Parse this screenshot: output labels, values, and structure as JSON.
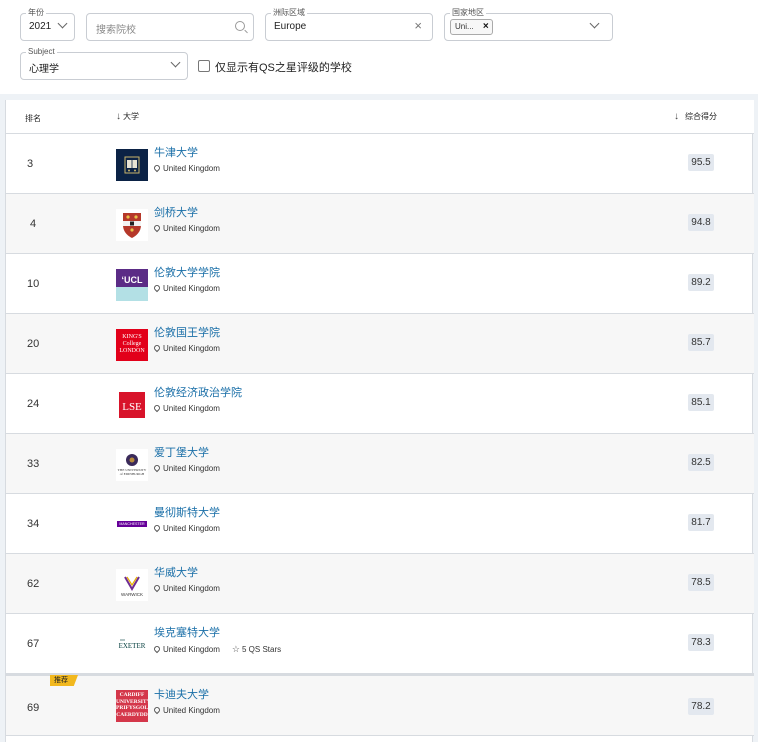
{
  "filters": {
    "year": {
      "legend": "年份",
      "value": "2021"
    },
    "search": {
      "placeholder": "搜索院校"
    },
    "region": {
      "legend": "洲际区域",
      "value": "Europe"
    },
    "country": {
      "legend": "国家地区",
      "chip": "Uni..."
    },
    "subject": {
      "legend": "Subject",
      "value": "心理学"
    },
    "qs_only_label": "仅显示有QS之星评级的学校"
  },
  "table": {
    "headers": {
      "rank": "排名",
      "university": "大学",
      "score": "综合得分"
    },
    "recommend_badge": "推荐",
    "rows": [
      {
        "rank": "3",
        "name": "牛津大学",
        "location": "United Kingdom",
        "score": "95.5"
      },
      {
        "rank": "4",
        "name": "剑桥大学",
        "location": "United Kingdom",
        "score": "94.8"
      },
      {
        "rank": "10",
        "name": "伦敦大学学院",
        "location": "United Kingdom",
        "score": "89.2"
      },
      {
        "rank": "20",
        "name": "伦敦国王学院",
        "location": "United Kingdom",
        "score": "85.7"
      },
      {
        "rank": "24",
        "name": "伦敦经济政治学院",
        "location": "United Kingdom",
        "score": "85.1"
      },
      {
        "rank": "33",
        "name": "爱丁堡大学",
        "location": "United Kingdom",
        "score": "82.5"
      },
      {
        "rank": "34",
        "name": "曼彻斯特大学",
        "location": "United Kingdom",
        "score": "81.7"
      },
      {
        "rank": "62",
        "name": "华威大学",
        "location": "United Kingdom",
        "score": "78.5"
      },
      {
        "rank": "67",
        "name": "埃克塞特大学",
        "location": "United Kingdom",
        "stars": "5 QS Stars",
        "score": "78.3"
      },
      {
        "rank": "69",
        "name": "卡迪夫大学",
        "location": "United Kingdom",
        "score": "78.2"
      }
    ],
    "logos": {
      "ucl": "‘UCL",
      "kings": "KING'S College LONDON",
      "lse": "LSE",
      "edinburgh": "THE UNIVERSITY of EDINBURGH",
      "manchester": "MANCHESTER 1824",
      "warwick": "WARWICK",
      "exeter": "EXETER",
      "cardiff": "CARDIFF UNIVERSITY PRIFYSGOL CAERDYDD"
    }
  }
}
